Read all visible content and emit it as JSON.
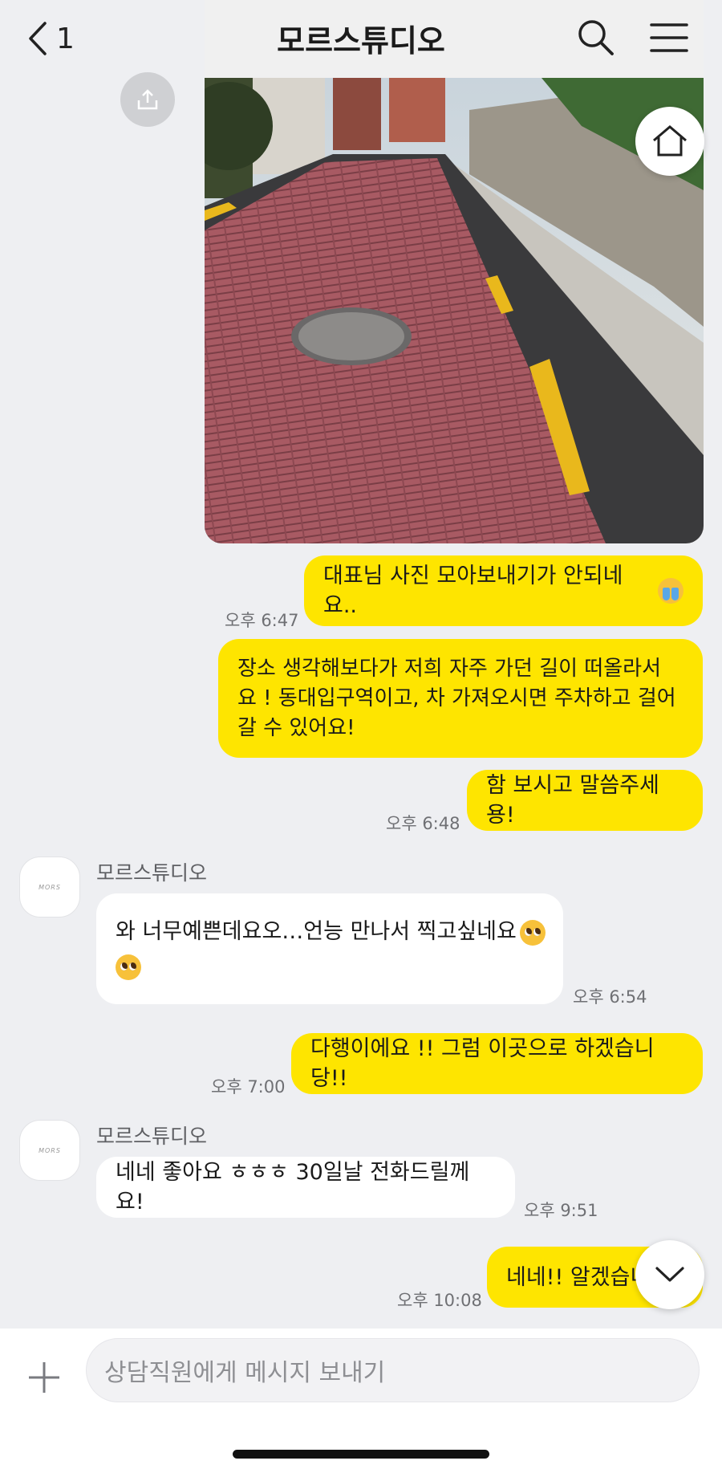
{
  "header": {
    "back_count": "1",
    "title": "모르스튜디오"
  },
  "messages": [
    {
      "id": "m1",
      "text": "대표님 사진 모아보내기가 안되네요..",
      "time": "오후 6:47"
    },
    {
      "id": "m2",
      "line1": "장소 생각해보다가 저희 자주 가던 길이 떠올라서",
      "line2": "요 ! 동대입구역이고, 차 가져오시면 주차하고 걸어",
      "line3": "갈 수 있어요!"
    },
    {
      "id": "m3",
      "text": "함 보시고 말씀주세용!",
      "time": "오후 6:48"
    },
    {
      "id": "m4",
      "sender": "모르스튜디오",
      "text": "와 너무예쁜데요오…언능 만나서 찍고싶네요",
      "time": "오후 6:54"
    },
    {
      "id": "m5",
      "text": "다행이에요 !! 그럼 이곳으로 하겠습니당!!",
      "time": "오후 7:00"
    },
    {
      "id": "m6",
      "sender": "모르스튜디오",
      "text": "네네 좋아요 ㅎㅎㅎ 30일날 전화드릴께요!",
      "time": "오후 9:51"
    },
    {
      "id": "m7",
      "text": "네네!! 알겠습니",
      "time": "오후 10:08"
    }
  ],
  "input": {
    "placeholder": "상담직원에게 메시지 보내기"
  },
  "colors": {
    "my_bubble": "#fee500",
    "their_bubble": "#ffffff",
    "background": "#eeeff2"
  },
  "icons": [
    "back-chevron-icon",
    "search-icon",
    "hamburger-menu-icon",
    "share-icon",
    "home-icon",
    "crying-face-emoji",
    "pleading-face-emoji",
    "chevron-down-icon",
    "plus-icon"
  ]
}
